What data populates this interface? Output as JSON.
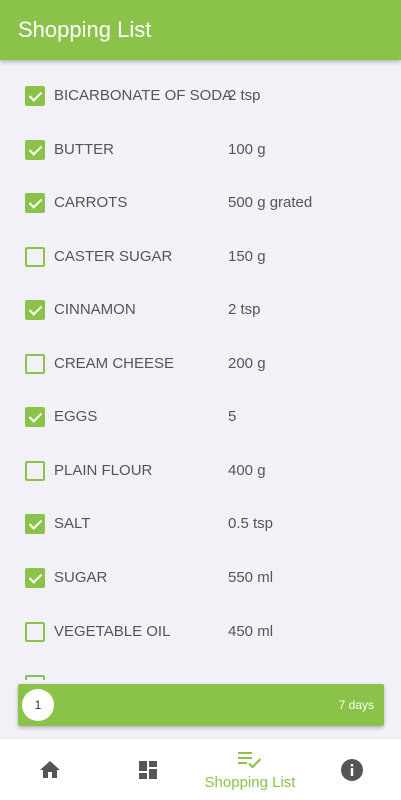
{
  "app_bar": {
    "title": "Shopping List"
  },
  "items": [
    {
      "name": "BICARBONATE OF SODA",
      "qty": "2 tsp",
      "checked": true
    },
    {
      "name": "BUTTER",
      "qty": "100 g",
      "checked": true
    },
    {
      "name": "CARROTS",
      "qty": "500 g grated",
      "checked": true
    },
    {
      "name": "CASTER SUGAR",
      "qty": "150 g",
      "checked": false
    },
    {
      "name": "CINNAMON",
      "qty": "2 tsp",
      "checked": true
    },
    {
      "name": "CREAM CHEESE",
      "qty": "200 g",
      "checked": false
    },
    {
      "name": "EGGS",
      "qty": "5",
      "checked": true
    },
    {
      "name": "PLAIN FLOUR",
      "qty": "400 g",
      "checked": false
    },
    {
      "name": "SALT",
      "qty": "0.5 tsp",
      "checked": true
    },
    {
      "name": "SUGAR",
      "qty": "550 ml",
      "checked": true
    },
    {
      "name": "VEGETABLE OIL",
      "qty": "450 ml",
      "checked": false
    }
  ],
  "plan_bar": {
    "badge": "1",
    "days": "7 days"
  },
  "bottom_nav": {
    "items": [
      {
        "icon": "home-icon",
        "label": ""
      },
      {
        "icon": "dashboard-icon",
        "label": ""
      },
      {
        "icon": "checklist-icon",
        "label": "Shopping List",
        "active": true
      },
      {
        "icon": "info-icon",
        "label": ""
      }
    ]
  },
  "colors": {
    "accent": "#8bc34a",
    "background": "#f2f1f8",
    "text": "#555555",
    "nav_icon": "#555555"
  }
}
